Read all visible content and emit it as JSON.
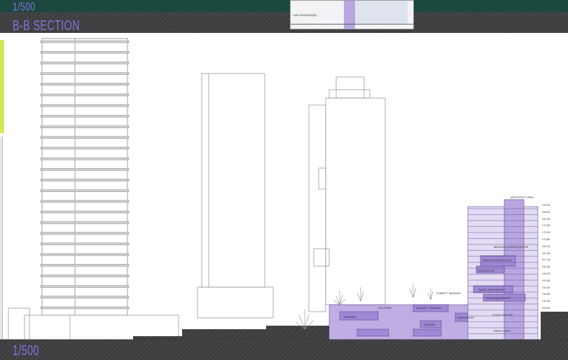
{
  "drawing": {
    "section_title": "B-B SECTION",
    "scale_top": "1/500",
    "scale_bottom": "1/500",
    "accent_color": "#8a70d8",
    "ground_color": "#3e3e40",
    "room_fill": "#b8a6e0"
  },
  "inset": {
    "label": "CAR PARKING(B1)"
  },
  "rooms": [
    {
      "label": "ARCHITECTURAL",
      "level": "top"
    },
    {
      "label": "PRAYER/MEDITATION"
    },
    {
      "label": "MEDICAL/CONSULTATION"
    },
    {
      "label": "EXHIBITION"
    },
    {
      "label": "MUSIC MEDITATION"
    },
    {
      "label": "CHARITY BAZAAR"
    },
    {
      "label": "YOGA EQUIPMENT"
    },
    {
      "label": "LECTURE"
    },
    {
      "label": "MANUEL TRAINING"
    },
    {
      "label": "YOGA CENTER"
    },
    {
      "label": "SEMINAR"
    },
    {
      "label": "WORKSHOP"
    },
    {
      "label": "LIBRARY"
    },
    {
      "label": "REFECTORY"
    },
    {
      "label": "CAR PARKING(B1)"
    },
    {
      "label": "CAR PARKING(B2)"
    }
  ],
  "levels": [
    "+93.35",
    "+88.85",
    "+84.35",
    "+79.85",
    "+75.35",
    "+70.85",
    "+66.35",
    "+61.85",
    "+57.35",
    "+52.85",
    "+48.35",
    "+43.85",
    "+39.35",
    "+34.85",
    "+30.35",
    "+25.85"
  ]
}
